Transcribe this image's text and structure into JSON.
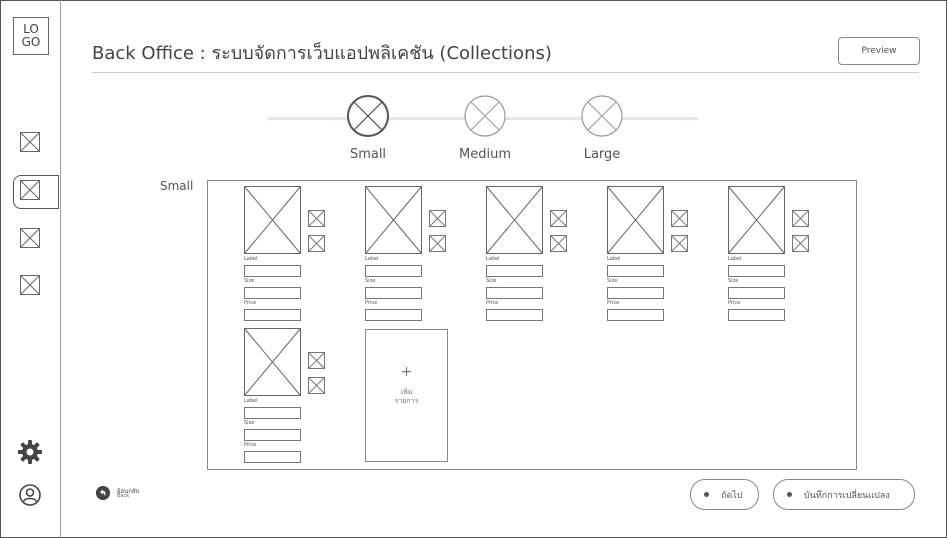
{
  "sidebar": {
    "logo": "LO\nGO",
    "logo_line1": "LO",
    "logo_line2": "GO",
    "icons": [
      "image-placeholder-icon",
      "image-placeholder-icon",
      "image-placeholder-icon",
      "image-placeholder-icon",
      "settings-gear-icon",
      "user-profile-icon"
    ]
  },
  "header": {
    "title": "Back Office : ระบบจัดการเว็บแอปพลิเคชัน (Collections)",
    "preview_label": "Preview"
  },
  "stepper": {
    "steps": [
      {
        "label": "Small",
        "active": true
      },
      {
        "label": "Medium",
        "active": false
      },
      {
        "label": "Large",
        "active": false
      }
    ]
  },
  "section": {
    "label": "Small",
    "card_fields": {
      "label": "Label",
      "size": "Size",
      "price": "Price"
    },
    "cards_count": 6,
    "add_item": {
      "plus": "+",
      "line1": "เพิ่ม",
      "line2": "รายการ"
    }
  },
  "footer": {
    "back_th": "ย้อนกลับ",
    "back_en": "Back",
    "next_label": "ถัดไป",
    "save_label": "บันทึกการเปลี่ยนแปลง"
  },
  "colors": {
    "border": "#888888",
    "track": "#e4e4f4",
    "text": "#555555"
  }
}
